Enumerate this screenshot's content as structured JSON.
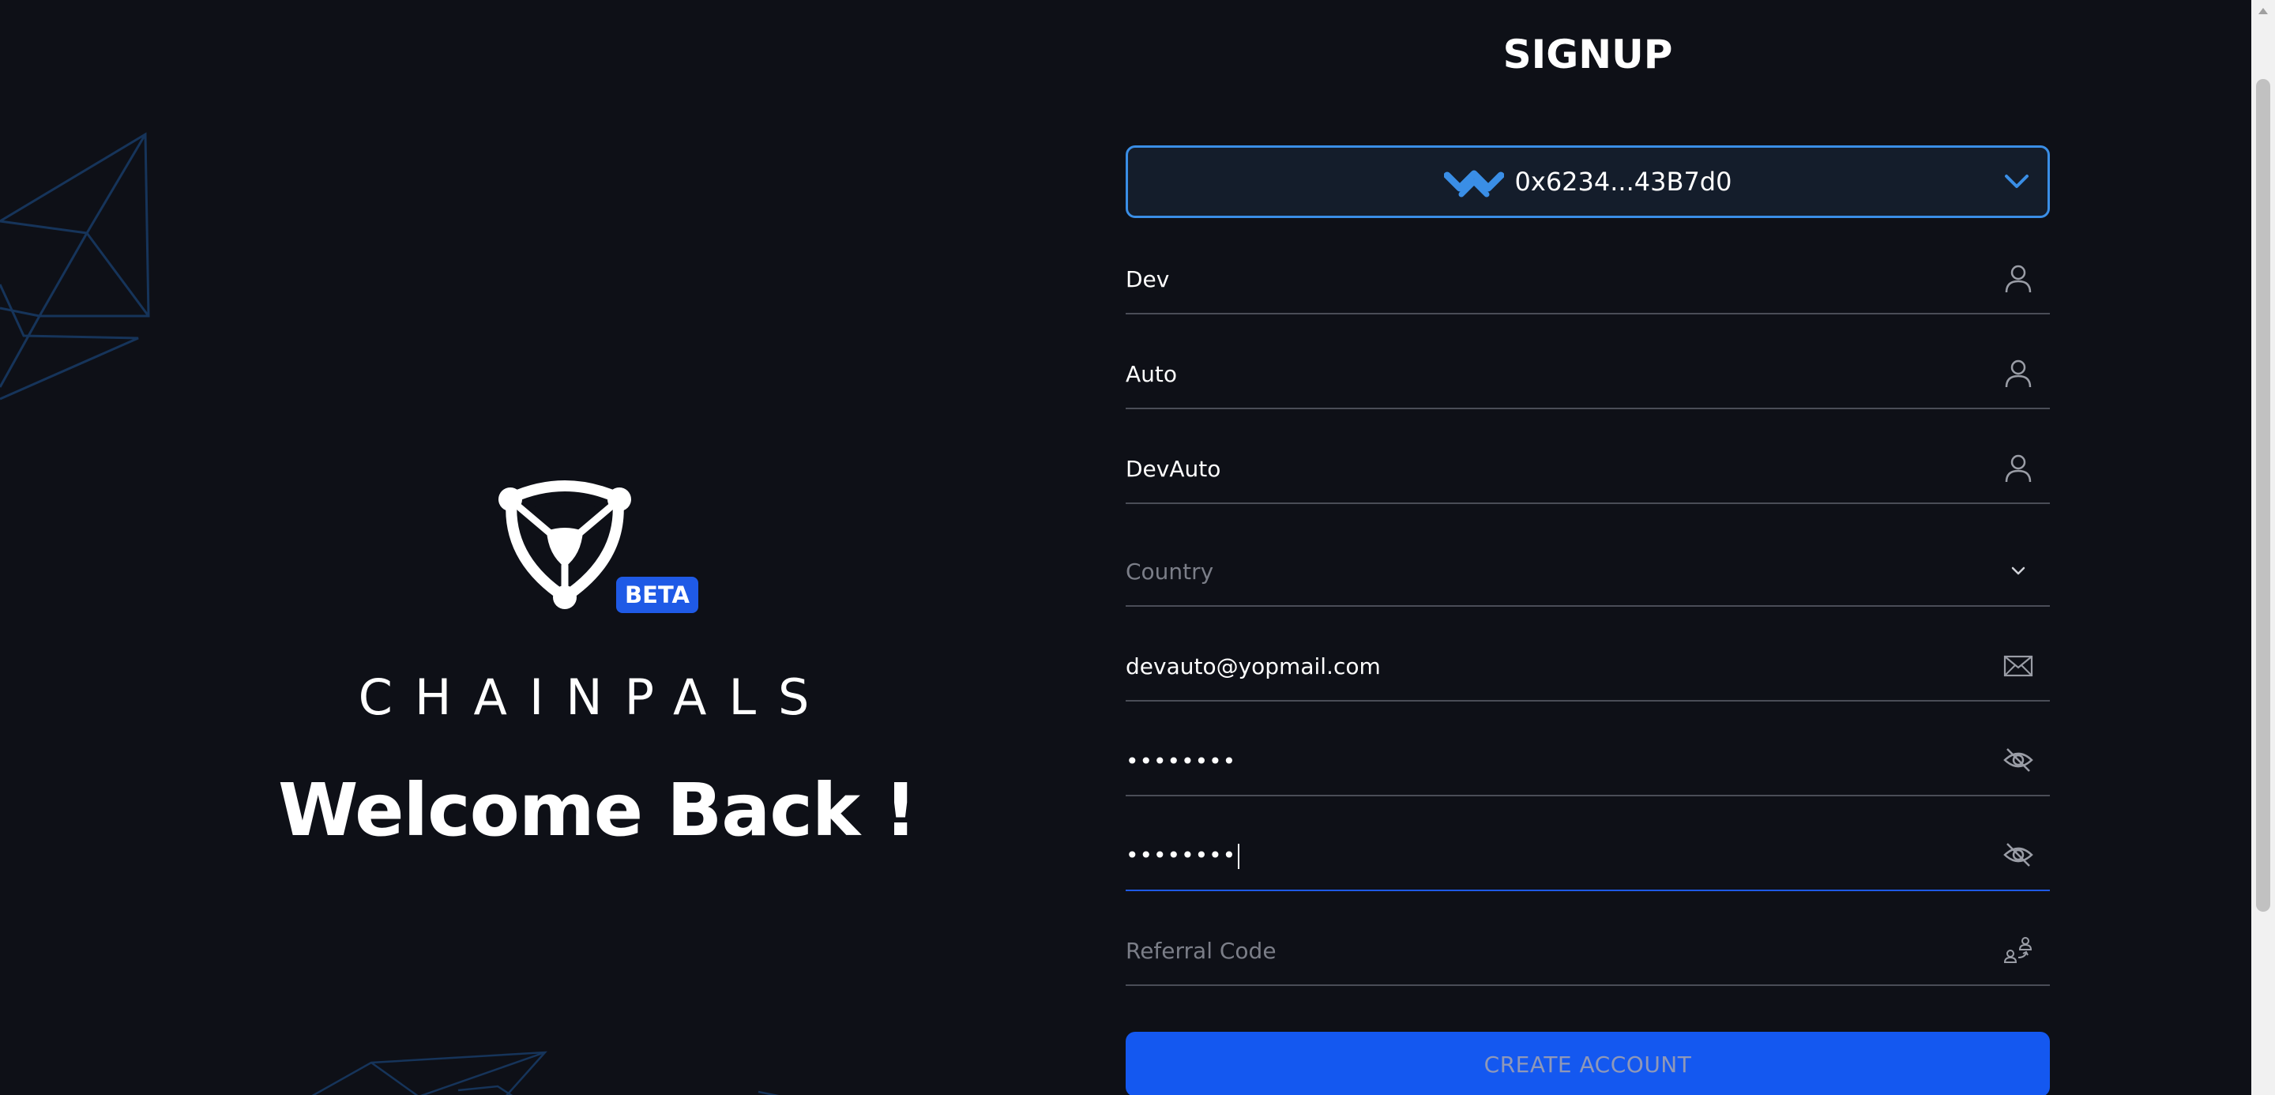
{
  "hero": {
    "badge": "BETA",
    "brand": "CHAINPALS",
    "welcome": "Welcome Back !"
  },
  "form": {
    "title": "SIGNUP",
    "wallet": {
      "address": "0x6234...43B7d0",
      "icon": "walletconnect-icon"
    },
    "fields": {
      "first_name": {
        "value": "Dev",
        "icon": "user-icon"
      },
      "last_name": {
        "value": "Auto",
        "icon": "user-icon"
      },
      "username": {
        "value": "DevAuto",
        "icon": "user-icon"
      },
      "country": {
        "placeholder": "Country",
        "icon": "chevron-down-icon"
      },
      "email": {
        "value": "devauto@yopmail.com",
        "icon": "mail-icon"
      },
      "password": {
        "value": "••••••••",
        "icon": "eye-off-icon"
      },
      "confirm_password": {
        "value": "••••••••",
        "icon": "eye-off-icon"
      },
      "referral": {
        "placeholder": "Referral Code",
        "icon": "referral-icon"
      }
    },
    "submit_label": "CREATE ACCOUNT"
  },
  "colors": {
    "background": "#0e1017",
    "accent": "#1458f0",
    "wallet_border": "#3a8ee6",
    "divider": "#4a4d57",
    "placeholder": "#7b7e88"
  }
}
